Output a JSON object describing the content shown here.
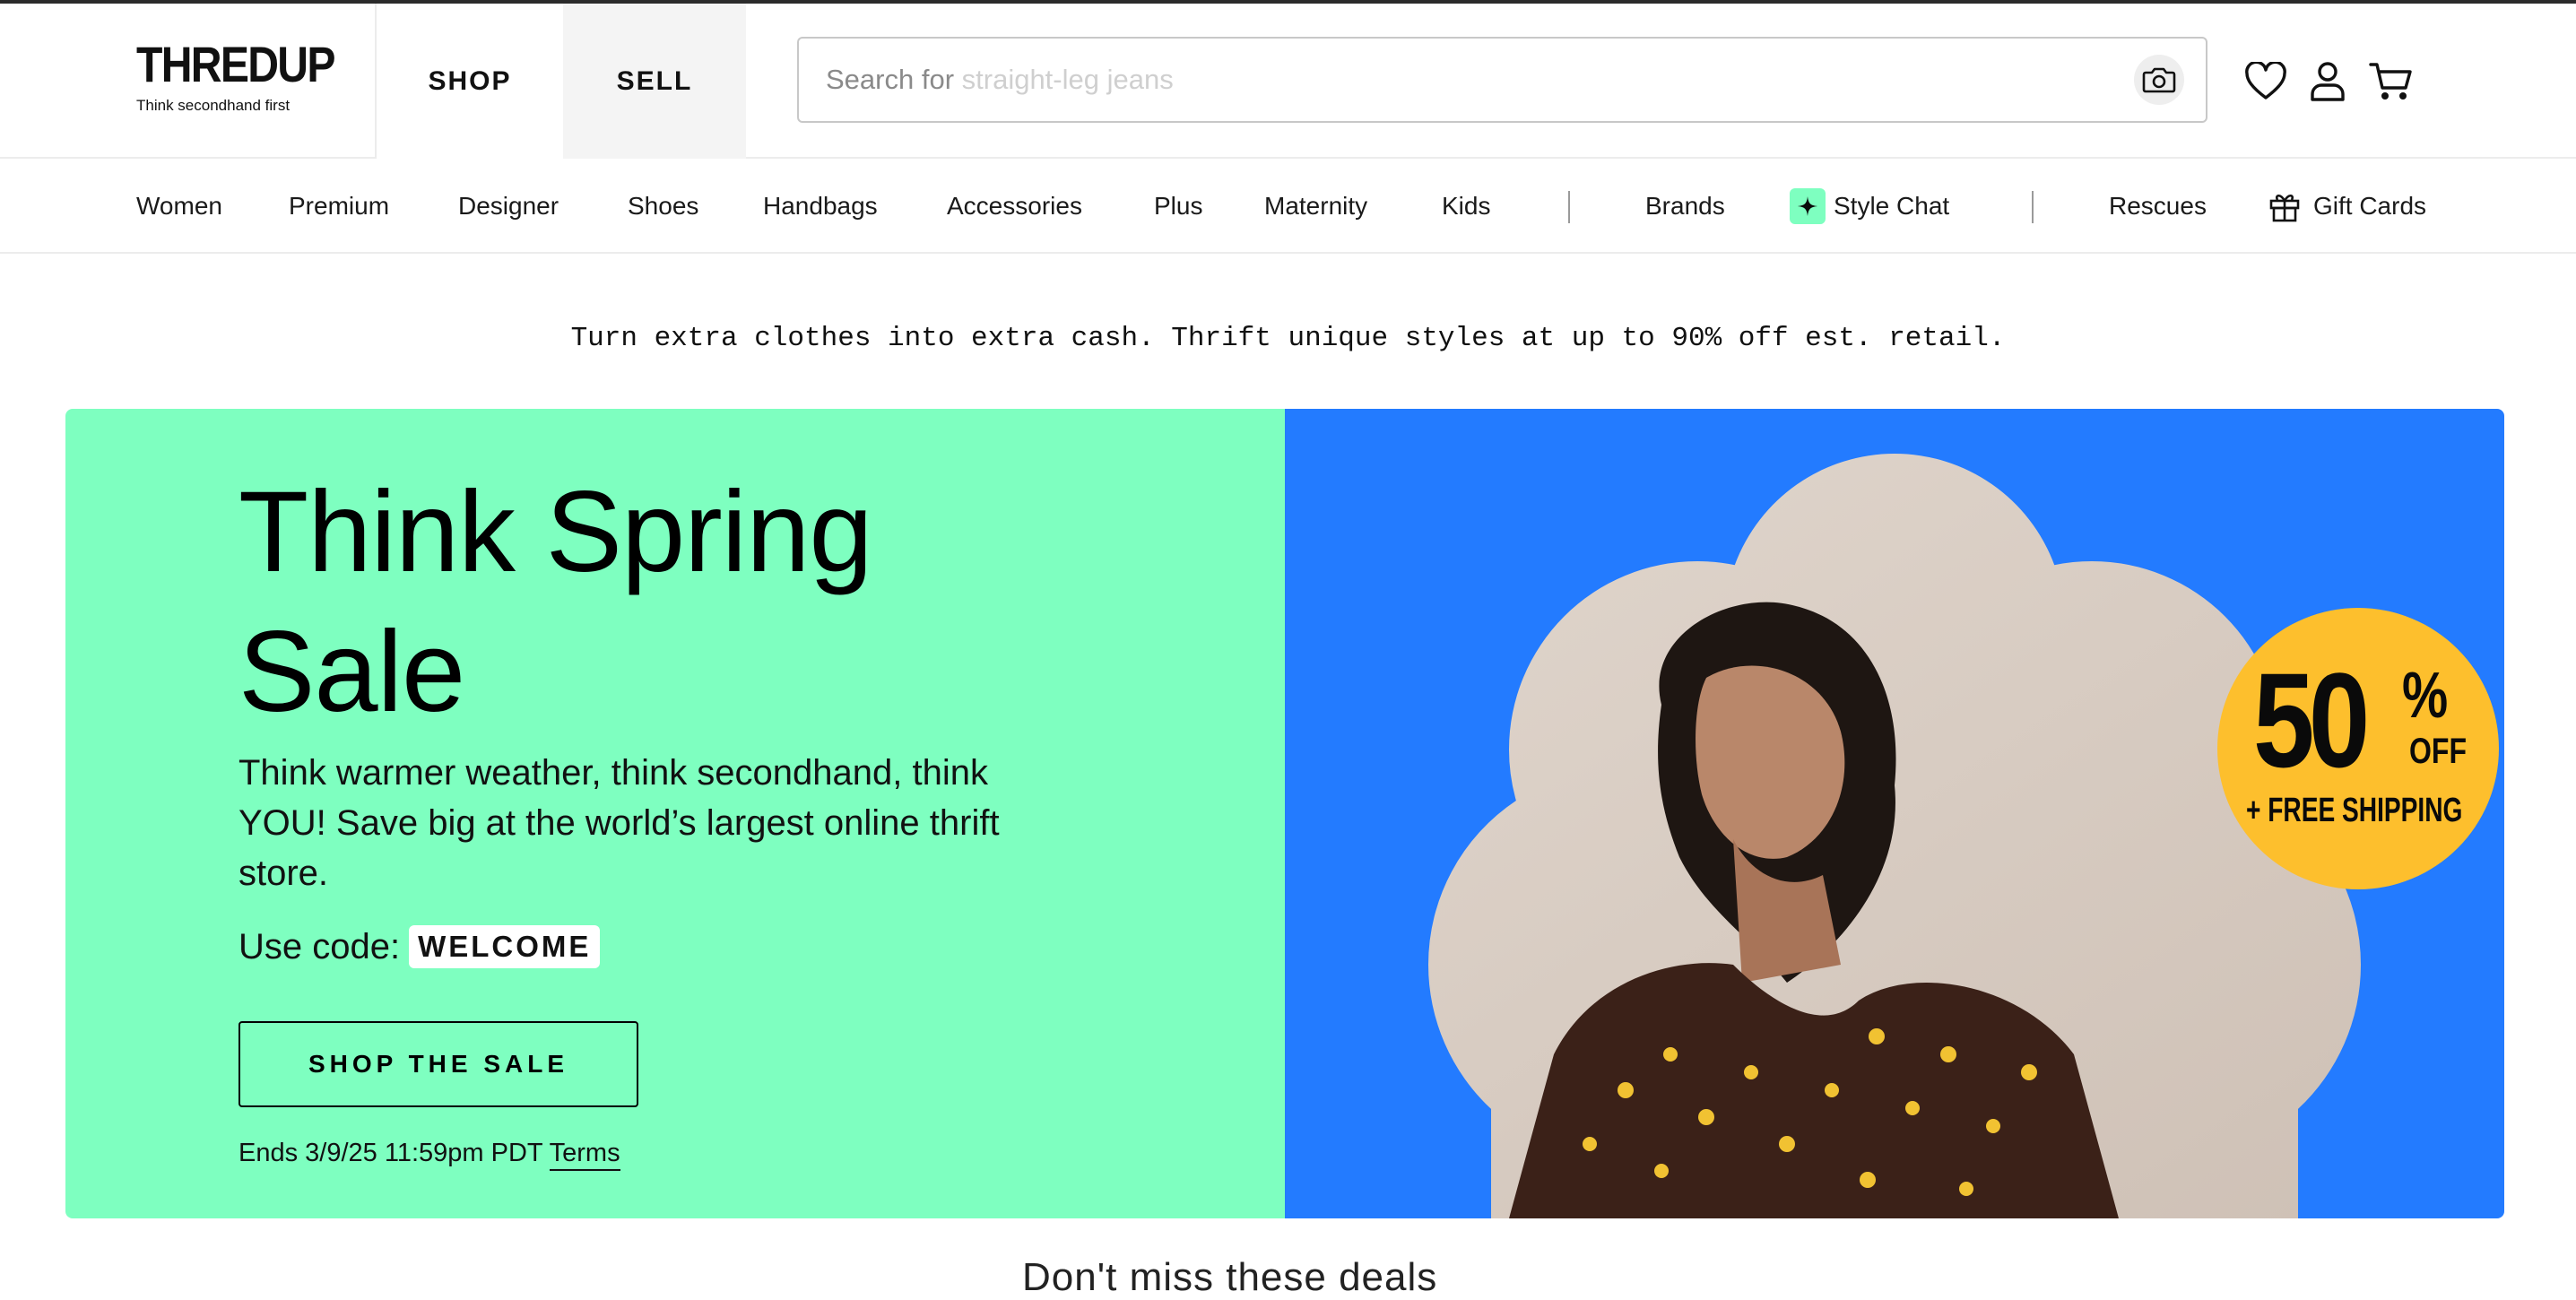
{
  "header": {
    "logo": {
      "wordmark": "THREDUP",
      "tagline": "Think secondhand first"
    },
    "tabs": {
      "shop": "SHOP",
      "sell": "SELL"
    },
    "search": {
      "prefix": "Search for",
      "hint": "straight-leg jeans"
    },
    "icons": [
      "camera-icon",
      "heart-icon",
      "user-icon",
      "cart-icon"
    ]
  },
  "nav": {
    "items": [
      "Women",
      "Premium",
      "Designer",
      "Shoes",
      "Handbags",
      "Accessories",
      "Plus",
      "Maternity",
      "Kids"
    ],
    "brands": "Brands",
    "style_chat": "Style Chat",
    "rescues": "Rescues",
    "gift_cards": "Gift Cards"
  },
  "tagline": "Turn extra clothes into extra cash. Thrift unique styles at up to 90% off est. retail.",
  "hero": {
    "title_line1": "Think Spring",
    "title_line2": "Sale",
    "body": "Think warmer weather, think secondhand, think YOU! Save big at the world’s largest online thrift store.",
    "code_label": "Use code:",
    "code": "WELCOME",
    "cta": "SHOP THE SALE",
    "ends": "Ends 3/9/25 11:59pm PDT",
    "terms": "Terms",
    "badge": {
      "percent": "50",
      "percent_sign": "%",
      "off": "OFF",
      "extra": "+ FREE SHIPPING"
    },
    "colors": {
      "left": "#7effc0",
      "right": "#237bff",
      "badge": "#fdbf2d"
    }
  },
  "below_fold": "Don't miss these deals"
}
